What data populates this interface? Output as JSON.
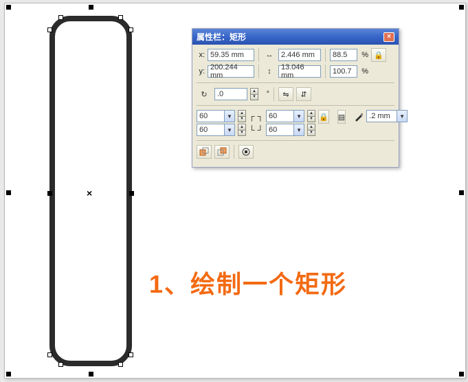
{
  "caption": "1、绘制一个矩形",
  "panel": {
    "title": "属性栏：矩形",
    "close_label": "×",
    "position": {
      "x_label": "x:",
      "x_value": "59.35 mm",
      "y_label": "y:",
      "y_value": "200.244 mm"
    },
    "size": {
      "w_value": "2.446 mm",
      "h_value": "13.046 mm"
    },
    "scale": {
      "x_value": "88.5",
      "y_value": "100.7",
      "unit": "%"
    },
    "rotation": {
      "value": ".0",
      "unit": "°"
    },
    "corners": {
      "tl": "60",
      "bl": "60",
      "tr": "60",
      "br": "60"
    },
    "outline_width": ".2 mm"
  },
  "icons": {
    "close": "close-icon",
    "lock": "lock-icon",
    "width_arrow": "width-arrow-icon",
    "height_arrow": "height-arrow-icon",
    "rotate": "rotate-icon",
    "mirror_h": "mirror-horizontal-icon",
    "mirror_v": "mirror-vertical-icon",
    "corner_tl": "corner-top-left-icon",
    "corner_bl": "corner-bottom-left-icon",
    "corner_tr": "corner-top-right-icon",
    "corner_br": "corner-bottom-right-icon",
    "corner_lock": "corner-lock-icon",
    "wrap_a": "text-wrap-icon",
    "outline": "outline-pen-icon",
    "to_curves": "to-curves-icon",
    "to_front": "to-front-icon",
    "to_back": "to-back-icon",
    "dropdown": "dropdown-icon",
    "spin_up": "spin-up-icon",
    "spin_down": "spin-down-icon"
  }
}
